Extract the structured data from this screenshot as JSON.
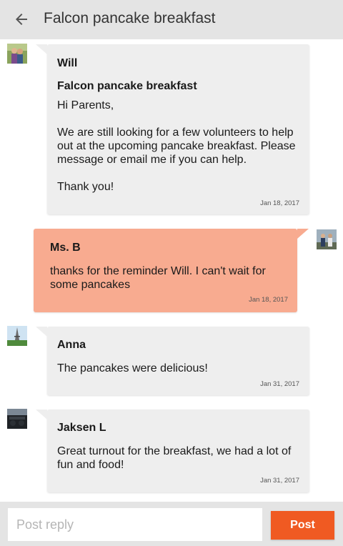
{
  "header": {
    "back_icon": "arrow-left-icon",
    "title": "Falcon pancake breakfast"
  },
  "messages": [
    {
      "author": "Will",
      "subject": "Falcon pancake breakfast",
      "body": "Hi Parents,\n\nWe are still looking for a few volunteers to help out at the upcoming pancake breakfast. Please message or email me if you can help.\n\nThank you!",
      "date": "Jan 18, 2017",
      "side": "left",
      "bubble_color": "#eeeeee"
    },
    {
      "author": "Ms. B",
      "body": "thanks for the reminder Will. I can't wait for some pancakes",
      "date": "Jan 18, 2017",
      "side": "right",
      "bubble_color": "#f8ab90"
    },
    {
      "author": "Anna",
      "body": "The pancakes were delicious!",
      "date": "Jan 31, 2017",
      "side": "left",
      "bubble_color": "#eeeeee"
    },
    {
      "author": "Jaksen L",
      "body": "Great turnout for the breakfast, we had a lot of fun and food!",
      "date": "Jan 31, 2017",
      "side": "left",
      "bubble_color": "#eeeeee"
    }
  ],
  "composer": {
    "placeholder": "Post reply",
    "value": "",
    "post_label": "Post",
    "post_color": "#f05a22"
  }
}
